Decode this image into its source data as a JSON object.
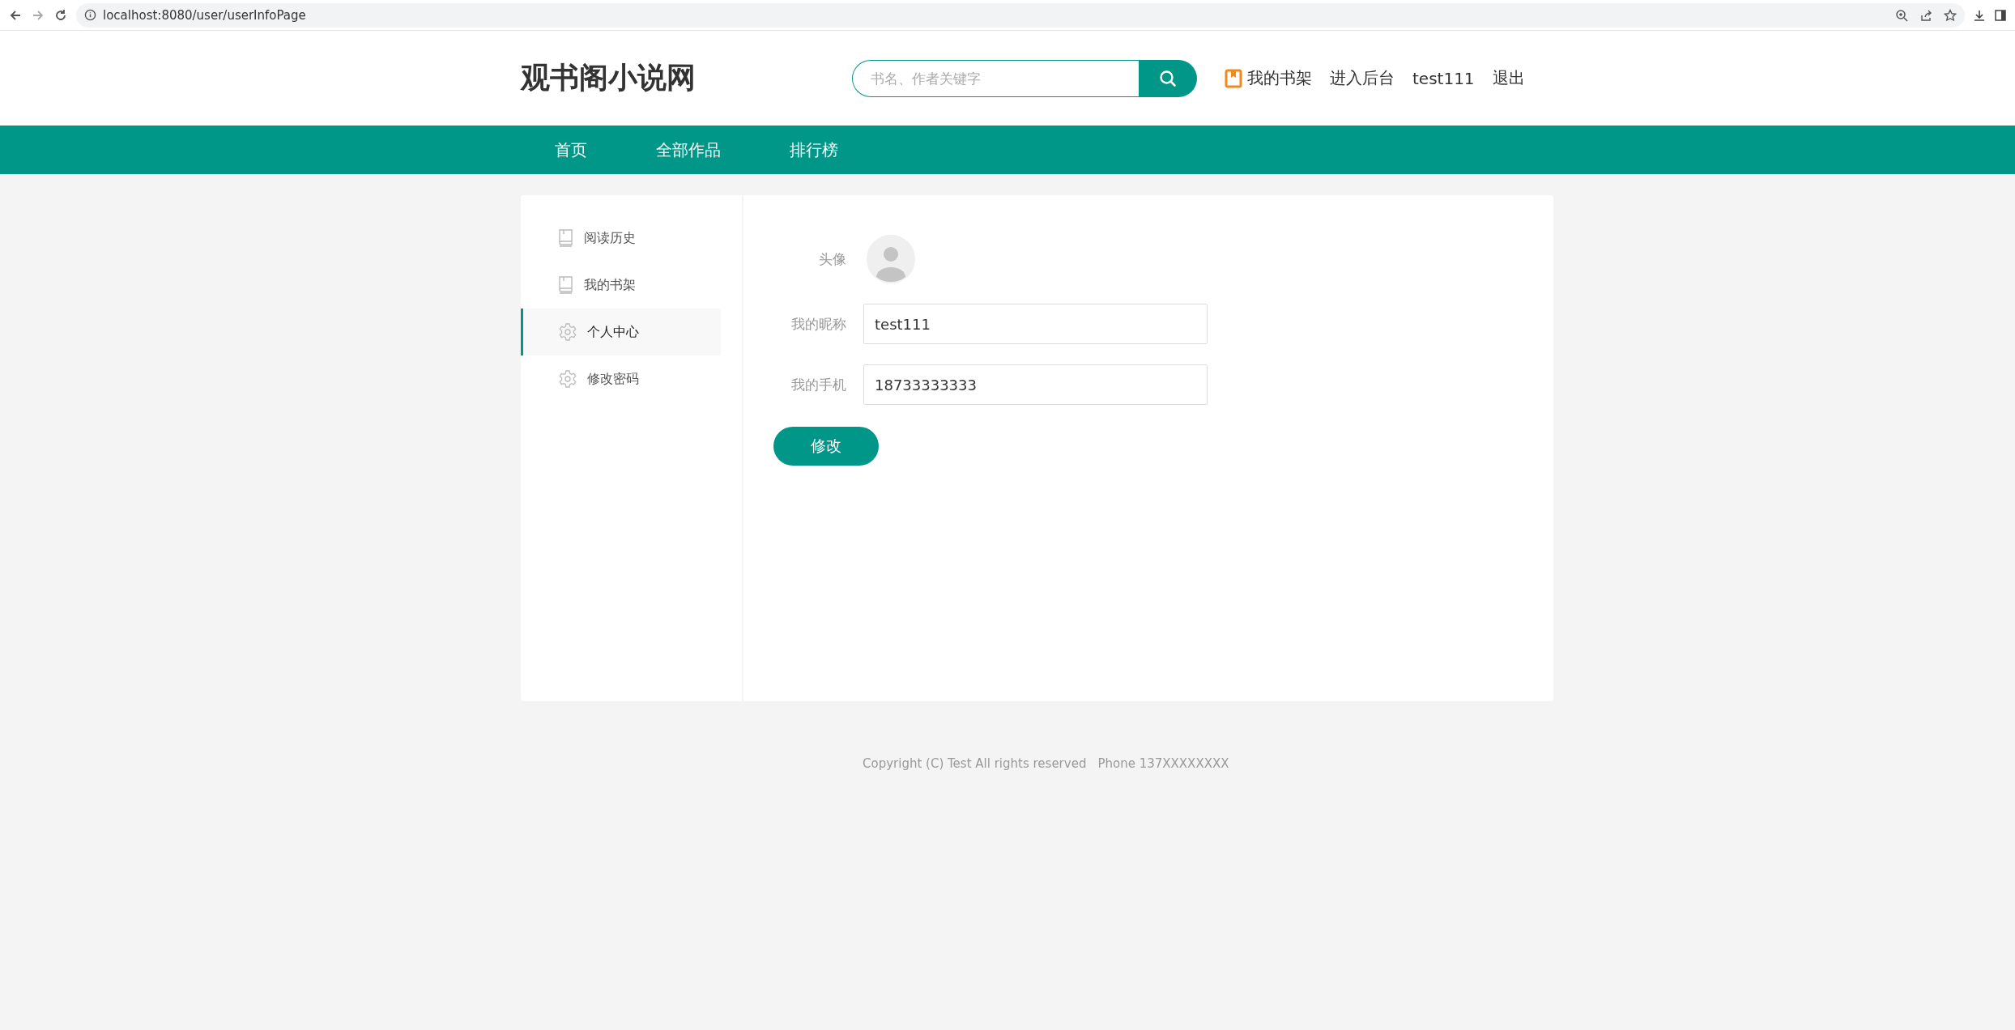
{
  "browser": {
    "url": "localhost:8080/user/userInfoPage"
  },
  "header": {
    "logo": "观书阁小说网",
    "search": {
      "placeholder": "书名、作者关键字"
    },
    "links": [
      {
        "label": "我的书架",
        "kind": "icon"
      },
      {
        "label": "进入后台",
        "kind": "plain"
      },
      {
        "label": "test111",
        "kind": "plain"
      },
      {
        "label": "退出",
        "kind": "plain"
      }
    ]
  },
  "nav": [
    {
      "label": "首页"
    },
    {
      "label": "全部作品"
    },
    {
      "label": "排行榜"
    }
  ],
  "sidebar": {
    "items": [
      {
        "label": "阅读历史",
        "kind": "book",
        "selected": false
      },
      {
        "label": "我的书架",
        "kind": "book",
        "selected": false
      },
      {
        "label": "个人中心",
        "kind": "gear",
        "selected": true
      },
      {
        "label": "修改密码",
        "kind": "gear",
        "selected": false
      }
    ]
  },
  "form": {
    "avatar_label": "头像",
    "fields": [
      {
        "label": "我的昵称",
        "value": "test111"
      },
      {
        "label": "我的手机",
        "value": "18733333333"
      }
    ],
    "submit": "修改"
  },
  "footer": {
    "copyright": "Copyright (C) Test All rights reserved",
    "phone": "Phone 137XXXXXXXX"
  }
}
